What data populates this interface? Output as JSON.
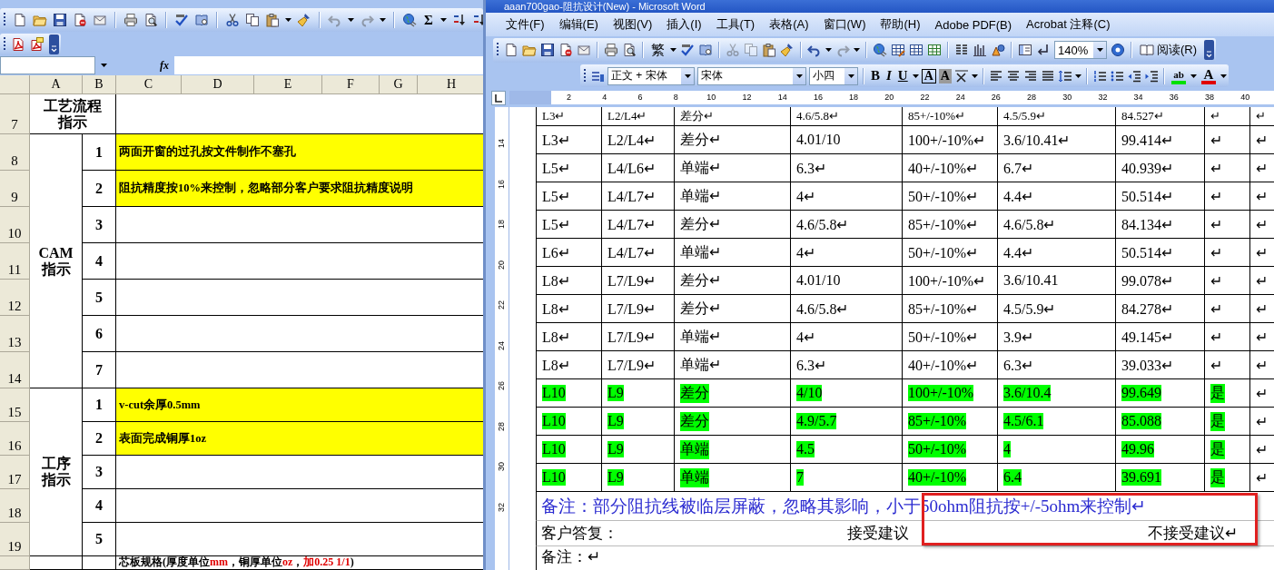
{
  "excel": {
    "standard_toolbar": {
      "sum_label": "Σ"
    },
    "formula_bar": {
      "function_label": "fx"
    },
    "columns": [
      "A",
      "B",
      "C",
      "D",
      "E",
      "F",
      "G",
      "H"
    ],
    "row_numbers": [
      "7",
      "8",
      "9",
      "10",
      "11",
      "12",
      "13",
      "14",
      "15",
      "16",
      "17",
      "18",
      "19"
    ],
    "process_header": "工艺流程指示",
    "sections": [
      {
        "title": "CAM指示",
        "items": [
          {
            "number": "1",
            "text": "两面开窗的过孔按文件制作不塞孔",
            "highlighted": true
          },
          {
            "number": "2",
            "text": "阻抗精度按10%来控制，忽略部分客户要求阻抗精度说明",
            "highlighted": true
          },
          {
            "number": "3",
            "highlighted": false
          },
          {
            "number": "4",
            "highlighted": false
          },
          {
            "number": "5",
            "highlighted": false
          },
          {
            "number": "6",
            "highlighted": false
          },
          {
            "number": "7",
            "highlighted": false
          }
        ]
      },
      {
        "title": "工序指示",
        "items": [
          {
            "number": "1",
            "text": "v-cut余厚0.5mm",
            "highlighted": true
          },
          {
            "number": "2",
            "text": "表面完成铜厚1oz",
            "highlighted": true
          },
          {
            "number": "3",
            "highlighted": false
          },
          {
            "number": "4",
            "highlighted": false
          },
          {
            "number": "5",
            "highlighted": false
          }
        ]
      }
    ],
    "footer_row": [
      {
        "text": "芯板规格(厚度单位",
        "red": false
      },
      {
        "text": "mm",
        "red": true
      },
      {
        "text": "，铜厚单位",
        "red": false
      },
      {
        "text": "oz",
        "red": true
      },
      {
        "text": "，",
        "red": false
      },
      {
        "text": "加0.25 1/1",
        "red": true
      },
      {
        "text": ")",
        "red": false
      }
    ]
  },
  "word": {
    "window": {
      "title": "aaan700gao-阻抗设计(New) - Microsoft Word"
    },
    "menu": [
      "文件(F)",
      "编辑(E)",
      "视图(V)",
      "插入(I)",
      "工具(T)",
      "表格(A)",
      "窗口(W)",
      "帮助(H)",
      "Adobe PDF(B)",
      "Acrobat 注释(C)"
    ],
    "standard_toolbar": {
      "traditional": "繁",
      "zoom": "140%",
      "read": "阅读(R)"
    },
    "format_toolbar": {
      "style": "正文 + 宋体",
      "font": "宋体",
      "size": "小四",
      "bold": "B",
      "italic": "I",
      "underline": "U",
      "border": "A",
      "shading": "A",
      "highlight": "ab",
      "font_color": "A"
    },
    "ruler": [
      "2",
      "4",
      "6",
      "8",
      "10",
      "12",
      "14",
      "16",
      "18",
      "20",
      "22",
      "24",
      "26",
      "28",
      "30",
      "32",
      "34",
      "36",
      "38",
      "40"
    ],
    "vertical_ruler": [
      "14",
      "16",
      "18",
      "20",
      "22",
      "24",
      "26",
      "28",
      "30",
      "32"
    ],
    "table": {
      "rows": [
        {
          "cells": [
            {
              "text": "L3↵",
              "highlighted": false
            },
            {
              "text": "L2/L4↵",
              "highlighted": false
            },
            {
              "text": "差分↵",
              "highlighted": false
            },
            {
              "text": "4.6/5.8↵",
              "highlighted": false
            },
            {
              "text": "85+/-10%↵",
              "highlighted": false
            },
            {
              "text": "4.5/5.9↵",
              "highlighted": false
            },
            {
              "text": "84.527↵",
              "highlighted": false
            },
            {
              "text": "↵",
              "highlighted": false
            },
            {
              "text": "↵",
              "highlighted": false
            }
          ]
        },
        {
          "cells": [
            {
              "text": "L3↵",
              "highlighted": false
            },
            {
              "text": "L2/L4↵",
              "highlighted": false
            },
            {
              "text": "差分↵",
              "highlighted": false
            },
            {
              "text": "4.01/10",
              "highlighted": false
            },
            {
              "text": "100+/-10%↵",
              "highlighted": false
            },
            {
              "text": "3.6/10.41↵",
              "highlighted": false
            },
            {
              "text": "99.414↵",
              "highlighted": false
            },
            {
              "text": "↵",
              "highlighted": false
            },
            {
              "text": "↵",
              "highlighted": false
            }
          ]
        },
        {
          "cells": [
            {
              "text": "L5↵",
              "highlighted": false
            },
            {
              "text": "L4/L6↵",
              "highlighted": false
            },
            {
              "text": "单端↵",
              "highlighted": false
            },
            {
              "text": "6.3↵",
              "highlighted": false
            },
            {
              "text": "40+/-10%↵",
              "highlighted": false
            },
            {
              "text": "6.7↵",
              "highlighted": false
            },
            {
              "text": "40.939↵",
              "highlighted": false
            },
            {
              "text": "↵",
              "highlighted": false
            },
            {
              "text": "↵",
              "highlighted": false
            }
          ]
        },
        {
          "cells": [
            {
              "text": "L5↵",
              "highlighted": false
            },
            {
              "text": "L4/L7↵",
              "highlighted": false
            },
            {
              "text": "单端↵",
              "highlighted": false
            },
            {
              "text": "4↵",
              "highlighted": false
            },
            {
              "text": "50+/-10%↵",
              "highlighted": false
            },
            {
              "text": "4.4↵",
              "highlighted": false
            },
            {
              "text": "50.514↵",
              "highlighted": false
            },
            {
              "text": "↵",
              "highlighted": false
            },
            {
              "text": "↵",
              "highlighted": false
            }
          ]
        },
        {
          "cells": [
            {
              "text": "L5↵",
              "highlighted": false
            },
            {
              "text": "L4/L7↵",
              "highlighted": false
            },
            {
              "text": "差分↵",
              "highlighted": false
            },
            {
              "text": "4.6/5.8↵",
              "highlighted": false
            },
            {
              "text": "85+/-10%↵",
              "highlighted": false
            },
            {
              "text": "4.6/5.8↵",
              "highlighted": false
            },
            {
              "text": "84.134↵",
              "highlighted": false
            },
            {
              "text": "↵",
              "highlighted": false
            },
            {
              "text": "↵",
              "highlighted": false
            }
          ]
        },
        {
          "cells": [
            {
              "text": "L6↵",
              "highlighted": false
            },
            {
              "text": "L4/L7↵",
              "highlighted": false
            },
            {
              "text": "单端↵",
              "highlighted": false
            },
            {
              "text": "4↵",
              "highlighted": false
            },
            {
              "text": "50+/-10%↵",
              "highlighted": false
            },
            {
              "text": "4.4↵",
              "highlighted": false
            },
            {
              "text": "50.514↵",
              "highlighted": false
            },
            {
              "text": "↵",
              "highlighted": false
            },
            {
              "text": "↵",
              "highlighted": false
            }
          ]
        },
        {
          "cells": [
            {
              "text": "L8↵",
              "highlighted": false
            },
            {
              "text": "L7/L9↵",
              "highlighted": false
            },
            {
              "text": "差分↵",
              "highlighted": false
            },
            {
              "text": "4.01/10",
              "highlighted": false
            },
            {
              "text": "100+/-10%↵",
              "highlighted": false
            },
            {
              "text": "3.6/10.41",
              "highlighted": false
            },
            {
              "text": "99.078↵",
              "highlighted": false
            },
            {
              "text": "↵",
              "highlighted": false
            },
            {
              "text": "↵",
              "highlighted": false
            }
          ]
        },
        {
          "cells": [
            {
              "text": "L8↵",
              "highlighted": false
            },
            {
              "text": "L7/L9↵",
              "highlighted": false
            },
            {
              "text": "差分↵",
              "highlighted": false
            },
            {
              "text": "4.6/5.8↵",
              "highlighted": false
            },
            {
              "text": "85+/-10%↵",
              "highlighted": false
            },
            {
              "text": "4.5/5.9↵",
              "highlighted": false
            },
            {
              "text": "84.278↵",
              "highlighted": false
            },
            {
              "text": "↵",
              "highlighted": false
            },
            {
              "text": "↵",
              "highlighted": false
            }
          ]
        },
        {
          "cells": [
            {
              "text": "L8↵",
              "highlighted": false
            },
            {
              "text": "L7/L9↵",
              "highlighted": false
            },
            {
              "text": "单端↵",
              "highlighted": false
            },
            {
              "text": "4↵",
              "highlighted": false
            },
            {
              "text": "50+/-10%↵",
              "highlighted": false
            },
            {
              "text": "3.9↵",
              "highlighted": false
            },
            {
              "text": "49.145↵",
              "highlighted": false
            },
            {
              "text": "↵",
              "highlighted": false
            },
            {
              "text": "↵",
              "highlighted": false
            }
          ]
        },
        {
          "cells": [
            {
              "text": "L8↵",
              "highlighted": false
            },
            {
              "text": "L7/L9↵",
              "highlighted": false
            },
            {
              "text": "单端↵",
              "highlighted": false
            },
            {
              "text": "6.3↵",
              "highlighted": false
            },
            {
              "text": "40+/-10%↵",
              "highlighted": false
            },
            {
              "text": "6.3↵",
              "highlighted": false
            },
            {
              "text": "39.033↵",
              "highlighted": false
            },
            {
              "text": "↵",
              "highlighted": false
            },
            {
              "text": "↵",
              "highlighted": false
            }
          ]
        },
        {
          "cells": [
            {
              "text": "L10",
              "highlighted": true
            },
            {
              "text": "L9",
              "highlighted": true
            },
            {
              "text": "差分",
              "highlighted": true
            },
            {
              "text": "4/10",
              "highlighted": true
            },
            {
              "text": "100+/-10%",
              "highlighted": true
            },
            {
              "text": "3.6/10.4",
              "highlighted": true
            },
            {
              "text": "99.649",
              "highlighted": true
            },
            {
              "text": "是",
              "highlighted": true
            },
            {
              "text": "↵",
              "highlighted": false
            }
          ]
        },
        {
          "cells": [
            {
              "text": "L10",
              "highlighted": true
            },
            {
              "text": "L9",
              "highlighted": true
            },
            {
              "text": "差分",
              "highlighted": true
            },
            {
              "text": "4.9/5.7",
              "highlighted": true
            },
            {
              "text": "85+/-10%",
              "highlighted": true
            },
            {
              "text": "4.5/6.1",
              "highlighted": true
            },
            {
              "text": "85.088",
              "highlighted": true
            },
            {
              "text": "是",
              "highlighted": true
            },
            {
              "text": "↵",
              "highlighted": false
            }
          ]
        },
        {
          "cells": [
            {
              "text": "L10",
              "highlighted": true
            },
            {
              "text": "L9",
              "highlighted": true
            },
            {
              "text": "单端",
              "highlighted": true
            },
            {
              "text": "4.5",
              "highlighted": true
            },
            {
              "text": "50+/-10%",
              "highlighted": true
            },
            {
              "text": "4",
              "highlighted": true
            },
            {
              "text": "49.96",
              "highlighted": true
            },
            {
              "text": "是",
              "highlighted": true
            },
            {
              "text": "↵",
              "highlighted": false
            }
          ]
        },
        {
          "cells": [
            {
              "text": "L10",
              "highlighted": true
            },
            {
              "text": "L9",
              "highlighted": true
            },
            {
              "text": "单端",
              "highlighted": true
            },
            {
              "text": "7",
              "highlighted": true
            },
            {
              "text": "40+/-10%",
              "highlighted": true
            },
            {
              "text": "6.4",
              "highlighted": true
            },
            {
              "text": "39.691",
              "highlighted": true
            },
            {
              "text": "是",
              "highlighted": true
            },
            {
              "text": "↵",
              "highlighted": false
            }
          ]
        }
      ]
    },
    "note": "备注：部分阻抗线被临层屏蔽，忽略其影响，小于50ohm阻抗按+/-5ohm来控制↵",
    "reply": {
      "label": "客户答复：",
      "accept": "接受建议",
      "reject": "不接受建议↵"
    },
    "remark": "备注：↵"
  }
}
